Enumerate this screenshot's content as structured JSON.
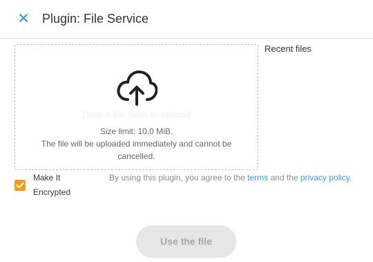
{
  "header": {
    "title": "Plugin: File Service",
    "close_icon": "close-icon"
  },
  "dropzone": {
    "icon": "cloud-upload-icon",
    "drop_label": "Drop a file here to upload",
    "size_limit": "Size limit: 10.0 MiB.",
    "upload_note": "The file will be uploaded immediately and cannot be cancelled."
  },
  "recent_files": {
    "label": "Recent files"
  },
  "encrypt": {
    "label": "Make It Encrypted",
    "checked": true
  },
  "agreement": {
    "prefix": "By using this plugin, you agree to the",
    "terms_link": "terms",
    "and_text": "and the",
    "privacy_link": "privacy policy",
    "suffix": "."
  },
  "actions": {
    "use_file_label": "Use the file",
    "use_file_enabled": false
  },
  "colors": {
    "accent_close": "#2ba0c9",
    "link": "#2ba0c9",
    "checkbox": "#f09d1e",
    "button_disabled_bg": "#e6e6e6",
    "button_disabled_text": "#a6a6a6"
  }
}
